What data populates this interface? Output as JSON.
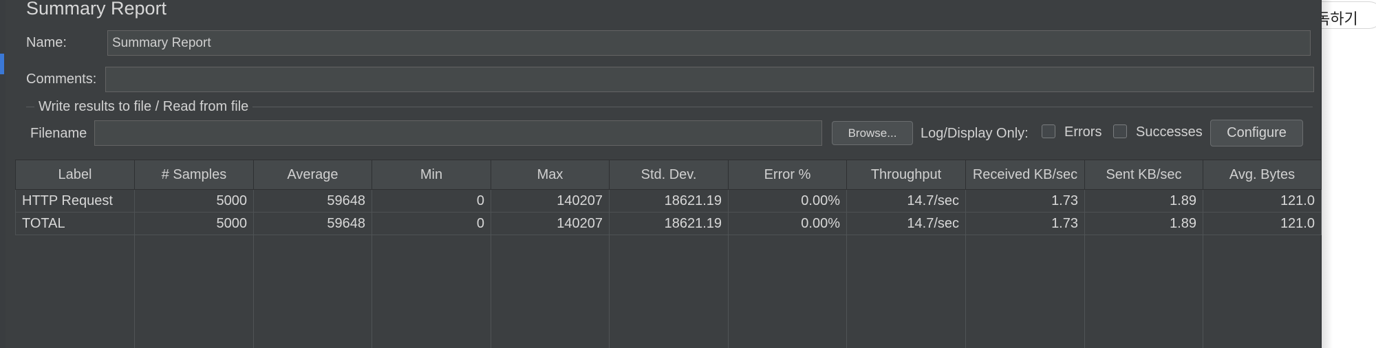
{
  "window": {
    "title": "Summary Report"
  },
  "form": {
    "name_label": "Name:",
    "name_value": "Summary Report",
    "comments_label": "Comments:",
    "comments_value": ""
  },
  "file_group": {
    "title": "Write results to file / Read from file",
    "filename_label": "Filename",
    "filename_value": "",
    "browse_label": "Browse...",
    "log_label": "Log/Display Only:",
    "errors_label": "Errors",
    "successes_label": "Successes",
    "configure_label": "Configure"
  },
  "table": {
    "columns": [
      "Label",
      "# Samples",
      "Average",
      "Min",
      "Max",
      "Std. Dev.",
      "Error %",
      "Throughput",
      "Received KB/sec",
      "Sent KB/sec",
      "Avg. Bytes"
    ],
    "rows": [
      [
        "HTTP Request",
        "5000",
        "59648",
        "0",
        "140207",
        "18621.19",
        "0.00%",
        "14.7/sec",
        "1.73",
        "1.89",
        "121.0"
      ],
      [
        "TOTAL",
        "5000",
        "59648",
        "0",
        "140207",
        "18621.19",
        "0.00%",
        "14.7/sec",
        "1.73",
        "1.89",
        "121.0"
      ]
    ]
  },
  "overlay": {
    "pill_text": "독하기"
  },
  "colors": {
    "panel_bg": "#3c3f41",
    "selection_accent": "#3b78d6"
  }
}
